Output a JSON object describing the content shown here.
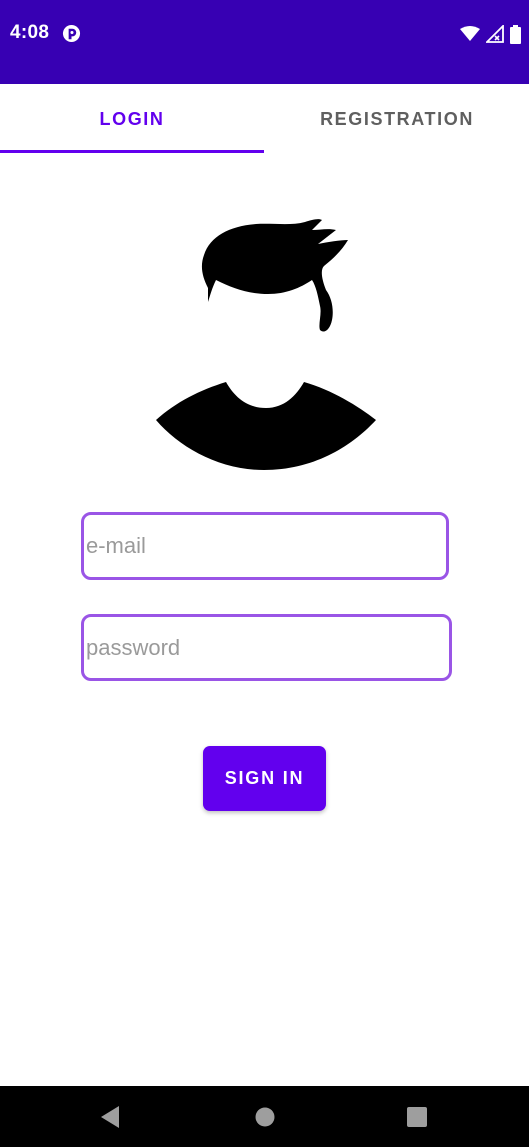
{
  "status_bar": {
    "time": "4:08",
    "background": "#3700b3",
    "icons": [
      "app-notification-icon",
      "wifi-icon",
      "signal-icon",
      "battery-icon"
    ]
  },
  "tabs": [
    {
      "label": "LOGIN",
      "selected": true
    },
    {
      "label": "REGISTRATION",
      "selected": false
    }
  ],
  "form": {
    "email_placeholder": "e-mail",
    "email_value": "",
    "password_placeholder": "password",
    "password_value": "",
    "signin_label": "SIGN IN"
  },
  "avatar": {
    "icon": "user-avatar-icon"
  },
  "nav_bar": {
    "icons": [
      "back-icon",
      "home-icon",
      "recents-icon"
    ]
  },
  "colors": {
    "accent": "#6200ee",
    "status_bar": "#3700b3",
    "field_border": "#9a55e6",
    "inactive_tab": "#5f5f5f"
  }
}
